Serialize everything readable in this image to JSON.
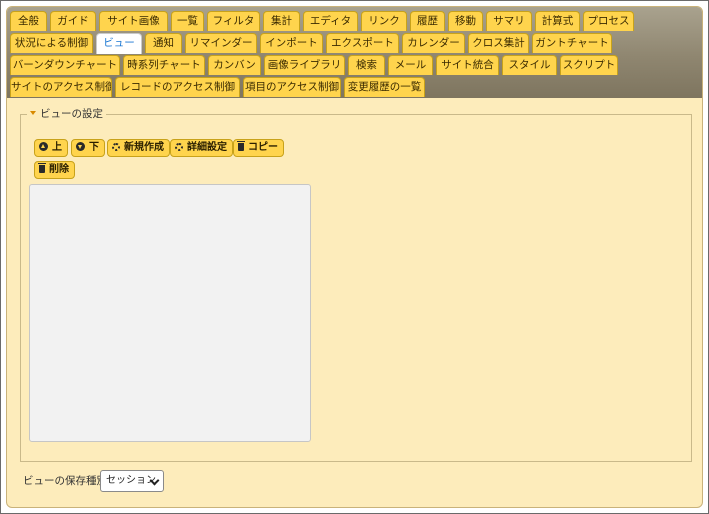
{
  "tabs": {
    "row1": [
      "全般",
      "ガイド",
      "サイト画像",
      "一覧",
      "フィルタ",
      "集計",
      "エディタ",
      "リンク",
      "履歴",
      "移動",
      "サマリ",
      "計算式",
      "プロセス"
    ],
    "row2": [
      "状況による制御",
      "ビュー",
      "通知",
      "リマインダー",
      "インポート",
      "エクスポート",
      "カレンダー",
      "クロス集計",
      "ガントチャート"
    ],
    "row3": [
      "バーンダウンチャート",
      "時系列チャート",
      "カンバン",
      "画像ライブラリ",
      "検索",
      "メール",
      "サイト統合",
      "スタイル",
      "スクリプト"
    ],
    "row4": [
      "サイトのアクセス制御",
      "レコードのアクセス制御",
      "項目のアクセス制御",
      "変更履歴の一覧"
    ],
    "active": "ビュー"
  },
  "view_settings": {
    "legend": "ビューの設定",
    "buttons": {
      "up": "上",
      "down": "下",
      "new": "新規作成",
      "advanced": "詳細設定",
      "copy": "コピー",
      "delete": "削除"
    },
    "list_items": []
  },
  "save_type": {
    "label": "ビューの保存種別",
    "selected": "セッション"
  }
}
